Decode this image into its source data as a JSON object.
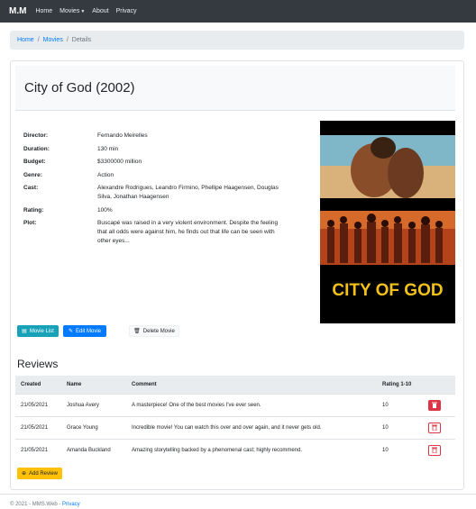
{
  "navbar": {
    "brand": "M.M",
    "links": [
      "Home",
      "Movies",
      "About",
      "Privacy"
    ]
  },
  "breadcrumb": {
    "home": "Home",
    "movies": "Movies",
    "current": "Details"
  },
  "movie": {
    "title": "City of God (2002)",
    "details": [
      {
        "label": "Director:",
        "value": "Fernando Meirelles"
      },
      {
        "label": "Duration:",
        "value": "130 min"
      },
      {
        "label": "Budget:",
        "value": "$3300000 million"
      },
      {
        "label": "Genre:",
        "value": "Action"
      },
      {
        "label": "Cast:",
        "value": "Alexandre Rodrigues, Leandro Firmino, Phellipe Haagensen, Douglas Silva, Jonathan Haagensen"
      },
      {
        "label": "Rating:",
        "value": "100%"
      },
      {
        "label": "Plot:",
        "value": "Buscapé was raised in a very violent environment. Despite the feeling that all odds were against him, he finds out that life can be seen with other eyes..."
      }
    ],
    "poster_text": "CITY OF GOD"
  },
  "actions": {
    "movie_list": "Movie List",
    "edit_movie": "Edit Movie",
    "delete_movie": "Delete Movie"
  },
  "reviews": {
    "title": "Reviews",
    "headers": {
      "created": "Created",
      "name": "Name",
      "comment": "Comment",
      "rating": "Rating 1-10"
    },
    "rows": [
      {
        "created": "21/05/2021",
        "name": "Joshua Avery",
        "comment": "A masterpiece! One of the best movies I've ever seen.",
        "rating": "10"
      },
      {
        "created": "21/05/2021",
        "name": "Grace Young",
        "comment": "Incredible movie! You can watch this over and over again, and it never gets old.",
        "rating": "10"
      },
      {
        "created": "21/05/2021",
        "name": "Amanda Buckland",
        "comment": "Amazing storytelling backed by a phenomenal cast; highly recommend.",
        "rating": "10"
      }
    ],
    "add_label": "Add Review"
  },
  "footer": {
    "text": "© 2021 - MMS.Web - ",
    "privacy": "Privacy"
  },
  "colors": {
    "navbar": "#343a40",
    "info": "#17a2b8",
    "primary": "#007bff",
    "danger": "#dc3545",
    "warning": "#ffc107"
  }
}
